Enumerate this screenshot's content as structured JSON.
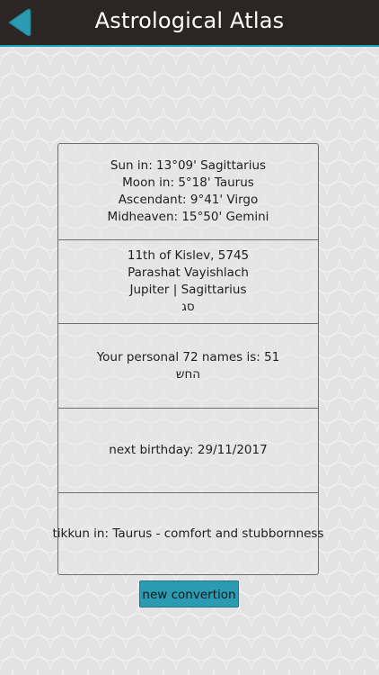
{
  "header": {
    "title": "Astrological Atlas",
    "back_icon": "back-arrow-icon",
    "accent_color": "#16a0b8",
    "background_color": "#2b2624"
  },
  "card": {
    "positions": {
      "sun": "Sun in: 13°09' Sagittarius",
      "moon": "Moon in: 5°18' Taurus",
      "ascendant": "Ascendant: 9°41' Virgo",
      "midheaven": "Midheaven: 15°50' Gemini"
    },
    "hebrew_date": {
      "date": "11th of Kislev, 5745",
      "parasha": "Parashat Vayishlach",
      "planet": "Jupiter | Sagittarius",
      "letters": "סג"
    },
    "names72": {
      "label": "Your personal 72 names is: 51",
      "name": "החש"
    },
    "birthday": {
      "label": "next birthday: 29/11/2017"
    },
    "tikkun": {
      "label": "tikkun in: Taurus - comfort and stubbornness"
    }
  },
  "actions": {
    "new_conversion_label": "new convertion",
    "button_color": "#2a9bb0"
  }
}
